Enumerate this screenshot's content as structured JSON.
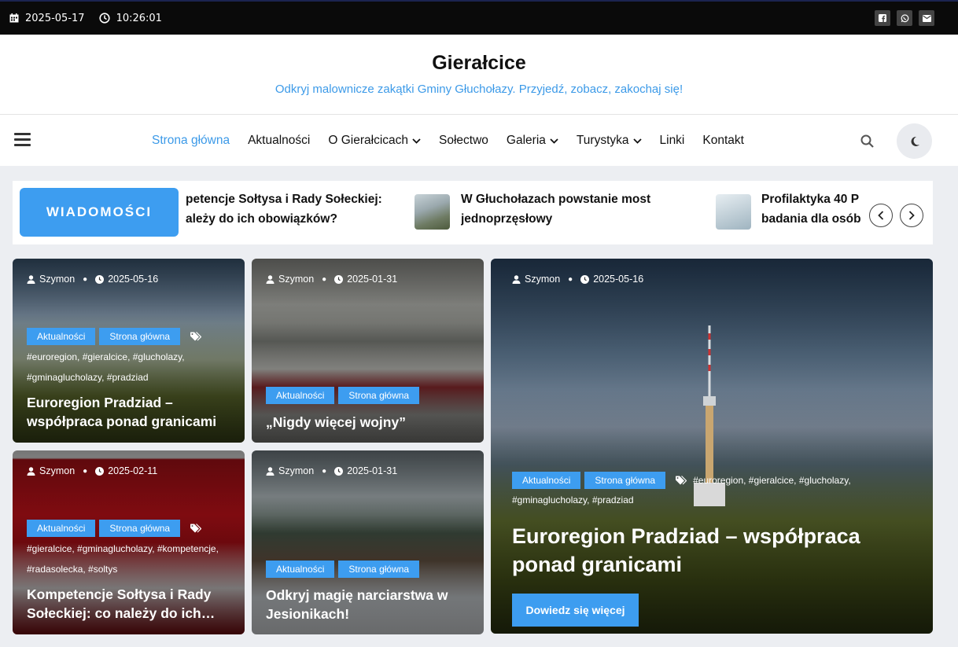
{
  "topbar": {
    "date": "2025-05-17",
    "time": "10:26:01"
  },
  "site": {
    "title": "Gierałcice",
    "tagline": "Odkryj malownicze zakątki Gminy Głuchołazy. Przyjedź, zobacz, zakochaj się!"
  },
  "nav": {
    "items": [
      {
        "label": "Strona główna"
      },
      {
        "label": "Aktualności"
      },
      {
        "label": "O Gierałcicach"
      },
      {
        "label": "Sołectwo"
      },
      {
        "label": "Galeria"
      },
      {
        "label": "Turystyka"
      },
      {
        "label": "Linki"
      },
      {
        "label": "Kontakt"
      }
    ]
  },
  "ticker": {
    "badge": "WIADOMOŚCI",
    "items": [
      {
        "line1": "petencje Sołtysa i Rady Sołeckiej:",
        "line2": "ależy do ich obowiązków?"
      },
      {
        "line1": "W Głuchołazach powstanie most",
        "line2": "jednoprzęsłowy"
      },
      {
        "line1": "Profilaktyka 40 P",
        "line2": "badania dla osób"
      }
    ]
  },
  "cards": [
    {
      "author": "Szymon",
      "date": "2025-05-16",
      "cats": [
        "Aktualności",
        "Strona główna"
      ],
      "tags1": "#euroregion, #gieralcice, #glucholazy,",
      "tags2": "#gminaglucholazy, #pradziad",
      "title1": "Euroregion Pradziad –",
      "title2": "współpraca ponad granicami"
    },
    {
      "author": "Szymon",
      "date": "2025-01-31",
      "cats": [
        "Aktualności",
        "Strona główna"
      ],
      "title1": "„Nigdy więcej wojny”"
    },
    {
      "author": "Szymon",
      "date": "2025-02-11",
      "cats": [
        "Aktualności",
        "Strona główna"
      ],
      "tags1": "#gieralcice, #gminaglucholazy, #kompetencje,",
      "tags2": "#radasolecka, #soltys",
      "title1": "Kompetencje Sołtysa i Rady",
      "title2": "Sołeckiej: co należy do ich…"
    },
    {
      "author": "Szymon",
      "date": "2025-01-31",
      "cats": [
        "Aktualności",
        "Strona główna"
      ],
      "title1": "Odkryj magię narciarstwa w",
      "title2": "Jesionikach!"
    }
  ],
  "featured": {
    "author": "Szymon",
    "date": "2025-05-16",
    "cats": [
      "Aktualności",
      "Strona główna"
    ],
    "tags1": "#euroregion, #gieralcice, #glucholazy,",
    "tags2": "#gminaglucholazy, #pradziad",
    "title1": "Euroregion Pradziad – współpraca",
    "title2": "ponad granicami",
    "button": "Dowiedz się więcej"
  }
}
